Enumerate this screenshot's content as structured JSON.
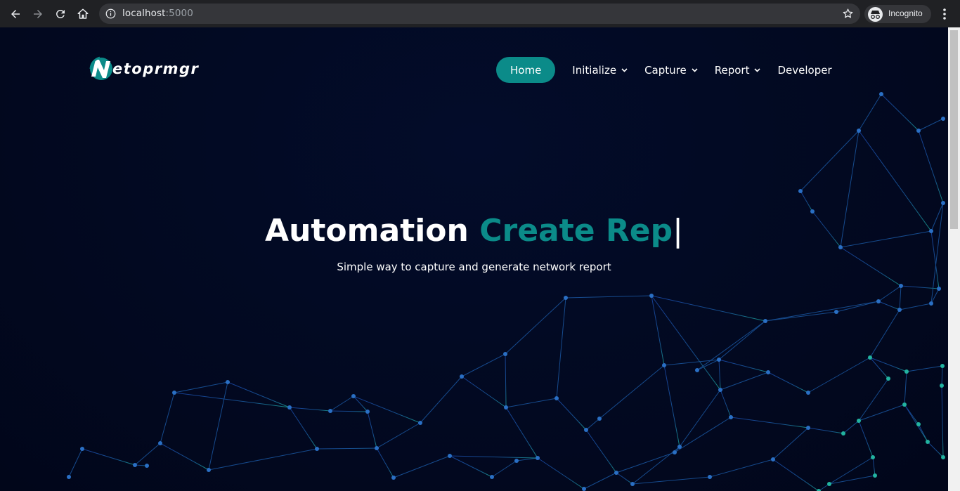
{
  "browser": {
    "url_host": "localhost",
    "url_port": ":5000",
    "profile_label": "Incognito"
  },
  "site": {
    "brand": "Netoprmgr",
    "brand_rest": "etoprmgr",
    "accent_color": "#0b8b89"
  },
  "nav": {
    "items": [
      {
        "label": "Home",
        "active": true,
        "dropdown": false
      },
      {
        "label": "Initialize",
        "active": false,
        "dropdown": true
      },
      {
        "label": "Capture",
        "active": false,
        "dropdown": true
      },
      {
        "label": "Report",
        "active": false,
        "dropdown": true
      },
      {
        "label": "Developer",
        "active": false,
        "dropdown": false
      }
    ]
  },
  "hero": {
    "title_static": "Automation",
    "title_typed": "Create Rep",
    "cursor": "|",
    "subtitle": "Simple way to capture and generate network report"
  }
}
